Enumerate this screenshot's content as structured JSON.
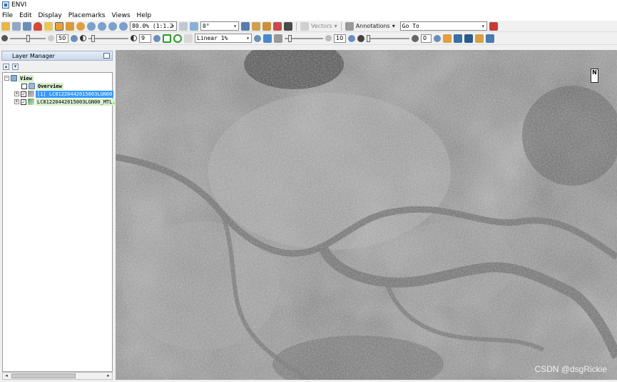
{
  "window": {
    "title": "ENVI"
  },
  "menu": [
    "File",
    "Edit",
    "Display",
    "Placemarks",
    "Views",
    "Help"
  ],
  "toolbar1": {
    "zoom": "80.0% (1:1.2",
    "rotation": "0°",
    "vectors_label": "Vectors",
    "annotations_label": "Annotations",
    "goto": "Go To"
  },
  "toolbar2": {
    "brightness_value": "50",
    "brightness_level": 0.5,
    "contrast_value": "9",
    "contrast_level": 0.08,
    "stretch": "Linear 1%",
    "sharpen_value": "10",
    "sharpen_level": 0.1,
    "transparency_value": "0",
    "transparency_level": 0.0
  },
  "layer_manager": {
    "title": "Layer Manager",
    "tree": [
      {
        "level": 0,
        "label": "View",
        "expander": "−",
        "checkbox": false,
        "style": "view",
        "icon": "view-icon"
      },
      {
        "level": 1,
        "label": "Overview",
        "expander": "",
        "checkbox": true,
        "checked": false,
        "style": "overview",
        "icon": "overview-icon"
      },
      {
        "level": 1,
        "label": "[1] LC81220442015003LGN00",
        "expander": "+",
        "checkbox": true,
        "checked": true,
        "style": "selected",
        "icon": "raster-layer-icon"
      },
      {
        "level": 1,
        "label": "LC81220442015003LGN00_MTL.",
        "expander": "+",
        "checkbox": true,
        "checked": true,
        "style": "green",
        "icon": "raster-layer-icon"
      }
    ]
  },
  "viewer": {
    "north_arrow": "N",
    "watermark": "CSDN @dsgRickie"
  },
  "colors": {
    "selection": "#3399ff",
    "layer_highlight": "#d7f0cf",
    "river": "#6e6e6e",
    "urban_light": "#c8c8c8"
  }
}
